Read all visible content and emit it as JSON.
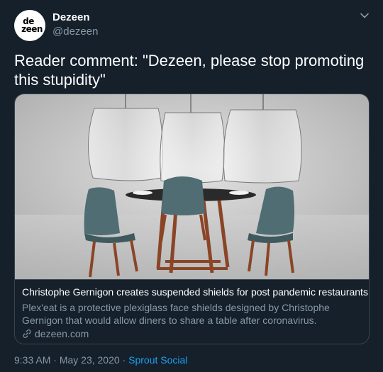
{
  "account": {
    "display_name": "Dezeen",
    "handle": "@dezeen",
    "avatar_line1": "de",
    "avatar_line2": "zeen"
  },
  "tweet": {
    "text": "Reader comment: \"Dezeen, please stop promoting this stupidity\""
  },
  "card": {
    "title": "Christophe Gernigon creates suspended shields for post pandemic restaurants",
    "description": "Plex'eat is a protective plexiglass face shields designed by Christophe Gernigon that would allow diners to share a table after coronavirus.",
    "domain": "dezeen.com"
  },
  "meta": {
    "time": "9:33 AM",
    "separator1": " · ",
    "date": "May 23, 2020",
    "separator2": " · ",
    "source": "Sprout Social"
  },
  "colors": {
    "background": "#15202b",
    "secondary_text": "#8899a6",
    "link": "#1da1f2",
    "border": "#38444d"
  }
}
